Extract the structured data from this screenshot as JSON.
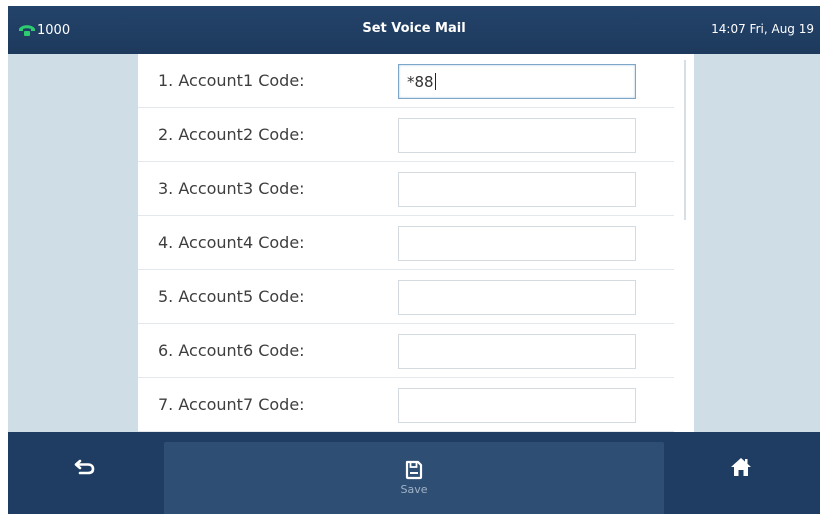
{
  "status_bar": {
    "line": "1000",
    "title": "Set Voice Mail",
    "datetime": "14:07 Fri, Aug 19"
  },
  "form": {
    "rows": [
      {
        "label": "1. Account1 Code:",
        "value": "*88"
      },
      {
        "label": "2. Account2 Code:",
        "value": ""
      },
      {
        "label": "3. Account3 Code:",
        "value": ""
      },
      {
        "label": "4. Account4 Code:",
        "value": ""
      },
      {
        "label": "5. Account5 Code:",
        "value": ""
      },
      {
        "label": "6. Account6 Code:",
        "value": ""
      },
      {
        "label": "7. Account7 Code:",
        "value": ""
      }
    ]
  },
  "softkeys": {
    "back_icon": "back-arrow-icon",
    "save_icon": "save-icon",
    "save_label": "Save",
    "home_icon": "home-icon"
  },
  "colors": {
    "status_bar": "#1d3a5d",
    "background": "#cfdde6",
    "softkey_bar": "#1f3d62",
    "phone_icon": "#2ecc71"
  }
}
